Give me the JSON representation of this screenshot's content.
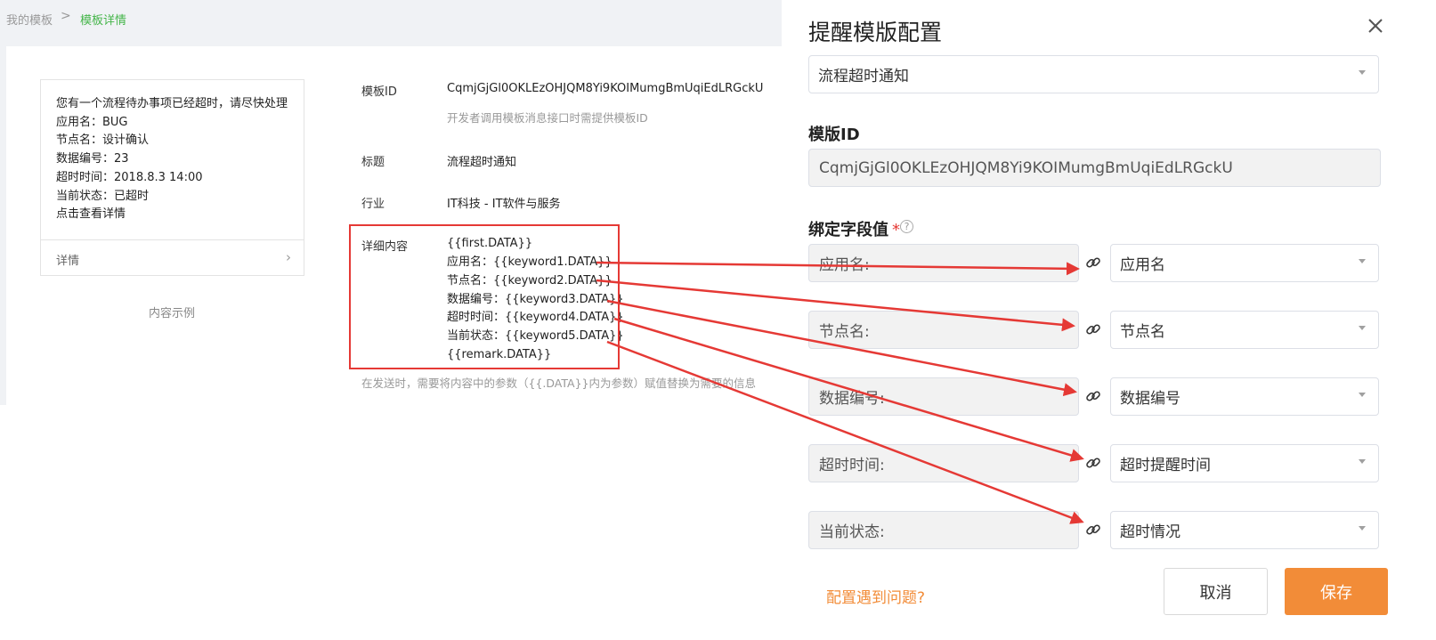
{
  "breadcrumb": {
    "parent": "我的模板",
    "separator": ">",
    "current": "模板详情"
  },
  "preview": {
    "lines": [
      "您有一个流程待办事项已经超时，请尽快处理",
      "应用名：BUG",
      "节点名：设计确认",
      "数据编号：23",
      "超时时间：2018.8.3 14:00",
      "当前状态：已超时",
      "点击查看详情"
    ],
    "detail_label": "详情",
    "caption": "内容示例"
  },
  "template_info": {
    "id_label": "模板ID",
    "id_value": "CqmjGjGl0OKLEzOHJQM8Yi9KOIMumgBmUqiEdLRGckU",
    "id_hint": "开发者调用模板消息接口时需提供模板ID",
    "title_label": "标题",
    "title_value": "流程超时通知",
    "industry_label": "行业",
    "industry_value": "IT科技 - IT软件与服务",
    "content_label": "详细内容",
    "content_lines": [
      "{{first.DATA}}",
      "应用名：{{keyword1.DATA}}",
      "节点名：{{keyword2.DATA}}",
      "数据编号：{{keyword3.DATA}}",
      "超时时间：{{keyword4.DATA}}",
      "当前状态：{{keyword5.DATA}}",
      "{{remark.DATA}}"
    ],
    "content_hint": "在发送时，需要将内容中的参数（{{.DATA}}内为参数）赋值替换为需要的信息"
  },
  "drawer": {
    "title": "提醒模版配置",
    "template_select": "流程超时通知",
    "template_id_label": "模版ID",
    "template_id_value": "CqmjGjGl0OKLEzOHJQM8Yi9KOIMumgBmUqiEdLRGckU",
    "bind_label": "绑定字段值",
    "required_mark": "*",
    "help_glyph": "?",
    "bindings": [
      {
        "field": "应用名:",
        "value": "应用名"
      },
      {
        "field": "节点名:",
        "value": "节点名"
      },
      {
        "field": "数据编号:",
        "value": "数据编号"
      },
      {
        "field": "超时时间:",
        "value": "超时提醒时间"
      },
      {
        "field": "当前状态:",
        "value": "超时情况"
      }
    ],
    "help_link": "配置遇到问题?",
    "cancel_label": "取消",
    "save_label": "保存"
  },
  "colors": {
    "accent": "#f28c38",
    "breadcrumb_active": "#44b549",
    "annotation": "#e53935"
  },
  "icons": [
    "chevron-right-icon",
    "close-icon",
    "chevron-down-icon",
    "link-icon",
    "question-circle-icon"
  ]
}
